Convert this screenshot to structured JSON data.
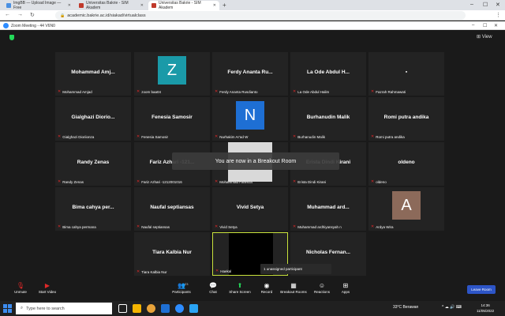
{
  "browser": {
    "tabs": [
      {
        "label": "ImgBB — Upload Image — Free",
        "color": "#4a90e2",
        "active": false
      },
      {
        "label": "Universitas Bakrie - SIM Akadem",
        "color": "#c0392b",
        "active": false
      },
      {
        "label": "Universitas Bakrie - SIM Akadem",
        "color": "#c0392b",
        "active": true
      }
    ],
    "new_tab": "+",
    "window_controls": [
      "–",
      "☐",
      "✕"
    ],
    "nav": [
      "←",
      "→",
      "↻"
    ],
    "url": "academic.bakrie.ac.id/siakad/virtualclass",
    "menu": "⋮"
  },
  "zoom": {
    "title": "Zoom Meeting - 44 V6N0",
    "window_controls": [
      "–",
      "☐",
      "✕"
    ],
    "view_label": "⊞ View",
    "banner": "You are now in a Breakout Room",
    "unassigned": "1 unassigned participant",
    "tiles": [
      {
        "big": "Mohammad  Amj...",
        "label": "Mohammad Amjad",
        "avatar": "",
        "color": ""
      },
      {
        "big": "",
        "label": "zoom baa04",
        "avatar": "Z",
        "color": "#1a9aa8"
      },
      {
        "big": "Ferdy  Ananta  Ru...",
        "label": "Ferdy Ananta Rusdianto",
        "avatar": "",
        "color": ""
      },
      {
        "big": "La  Ode  Abdul  H...",
        "label": "La Ode Abdul Halim",
        "avatar": "",
        "color": ""
      },
      {
        "big": "▪",
        "label": "Fazrah Rahmawati",
        "avatar": "",
        "color": ""
      },
      {
        "big": "Gialghazi  Diorio...",
        "label": "Gialghazi Dioriionza",
        "avatar": "",
        "color": ""
      },
      {
        "big": "Fenesia  Samosir",
        "label": "Fenesia Samosir",
        "avatar": "",
        "color": ""
      },
      {
        "big": "",
        "label": "Nurhakim Ar'ad W",
        "avatar": "N",
        "color": "#1e6fd4"
      },
      {
        "big": "Burhanudin  Malik",
        "label": "Burhanudin Malik",
        "avatar": "",
        "color": ""
      },
      {
        "big": "Romi  putra  andika",
        "label": "Romi putra andika",
        "avatar": "",
        "color": ""
      },
      {
        "big": "Randy  Zenas",
        "label": "Randy Zenas",
        "avatar": "",
        "color": ""
      },
      {
        "big": "Fariz  Azhari  -121...",
        "label": "Fariz Azhari -1212001016",
        "avatar": "",
        "color": ""
      },
      {
        "big": "",
        "label": "Mohammad Fahreza",
        "avatar": "",
        "color": "#d9d9d9"
      },
      {
        "big": "Erista  Dindi  Kirani",
        "label": "Erista Dindi Kirani",
        "avatar": "",
        "color": ""
      },
      {
        "big": "oldeno",
        "label": "oldeno",
        "avatar": "",
        "color": ""
      },
      {
        "big": "Bima  cahya  per...",
        "label": "Bima cahya permana",
        "avatar": "",
        "color": ""
      },
      {
        "big": "Naufal  septiansas",
        "label": "Naufal septiansas",
        "avatar": "",
        "color": ""
      },
      {
        "big": "Vivid  Setya",
        "label": "Vivid Setya",
        "avatar": "",
        "color": ""
      },
      {
        "big": "Muhammad  ard...",
        "label": "Muhammad ardhiyansyah n",
        "avatar": "",
        "color": ""
      },
      {
        "big": "",
        "label": "Ardya Wira",
        "avatar": "A",
        "color": "#8c6a5a"
      },
      {
        "big": "Tiara  Kalbia  Nur",
        "label": "Tiara Kalbia Nur",
        "avatar": "",
        "color": ""
      },
      {
        "big": "",
        "label": "Haekal",
        "avatar": "",
        "color": "#000000"
      },
      {
        "big": "Nicholas  Fernan...",
        "label": "Putra M",
        "avatar": "",
        "color": ""
      }
    ],
    "toolbar": {
      "unmute": "Unmute",
      "start_video": "Start Video",
      "participants": "Participants",
      "participants_count": "23",
      "chat": "Chat",
      "share": "Share Screen",
      "record": "Record",
      "breakout": "Breakout Rooms",
      "reactions": "Reactions",
      "apps": "Apps",
      "leave": "Leave Room"
    }
  },
  "taskbar": {
    "search_placeholder": "Type here to search",
    "weather": "33°C  Berawan",
    "time": "14:36",
    "date": "11/05/2022",
    "icon_colors": [
      "#ffffff",
      "#f4b400",
      "#e8a33a",
      "#1e6fd4",
      "#2d8cff",
      "#2aa4f4"
    ]
  }
}
